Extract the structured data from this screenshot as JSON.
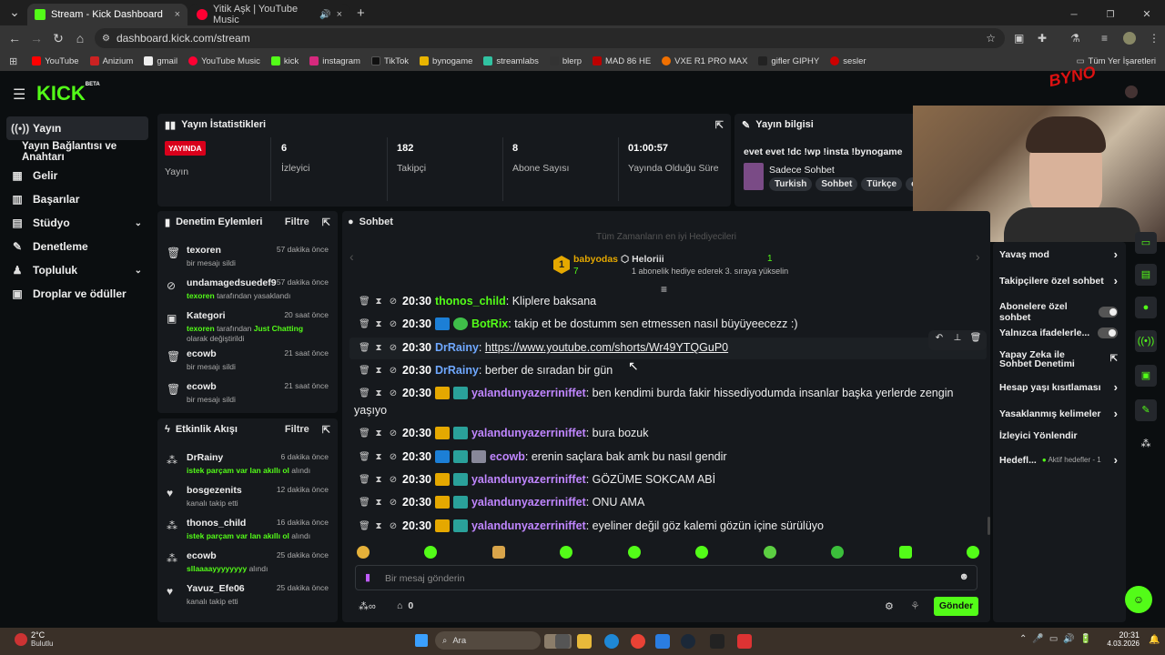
{
  "tabs": [
    {
      "title": "Stream - Kick Dashboard",
      "close": "×"
    },
    {
      "title": "Yitik Aşk | YouTube Music",
      "close": "×"
    }
  ],
  "new_tab": "+",
  "window_controls": {
    "min": "─",
    "max": "❐",
    "close": "✕"
  },
  "url": "dashboard.kick.com/stream",
  "bookmarks": [
    "YouTube",
    "Anizium",
    "gmail",
    "YouTube Music",
    "kick",
    "instagram",
    "TikTok",
    "bynogame",
    "streamlabs",
    "blerp",
    "MAD 86 HE",
    "VXE R1 PRO MAX",
    "gifler GIPHY",
    "sesler"
  ],
  "bookmarks_all": "Tüm Yer İşaretleri",
  "logo": "KICK",
  "logo_beta": "BETA",
  "sidebar": {
    "items": [
      {
        "label": "Yayın",
        "icon": "stream-icon"
      },
      {
        "label": "Yayın Bağlantısı ve Anahtarı",
        "icon": ""
      },
      {
        "label": "Gelir",
        "icon": "revenue-icon"
      },
      {
        "label": "Başarılar",
        "icon": "trophy-icon"
      },
      {
        "label": "Stüdyo",
        "icon": "studio-icon",
        "chev": "⌄"
      },
      {
        "label": "Denetleme",
        "icon": "wrench-icon"
      },
      {
        "label": "Topluluk",
        "icon": "community-icon",
        "chev": "⌄"
      },
      {
        "label": "Droplar ve ödüller",
        "icon": "drops-icon"
      }
    ]
  },
  "stats": {
    "title": "Yayın İstatistikleri",
    "live_badge": "YAYINDA",
    "items": [
      {
        "value": "",
        "label": "Yayın"
      },
      {
        "value": "6",
        "label": "İzleyici"
      },
      {
        "value": "182",
        "label": "Takipçi"
      },
      {
        "value": "8",
        "label": "Abone Sayısı"
      },
      {
        "value": "01:00:57",
        "label": "Yayında Olduğu Süre"
      }
    ]
  },
  "info": {
    "title": "Yayın bilgisi",
    "stream_title": "evet evet !dc !wp !insta !bynogame",
    "category": "Sadece Sohbet",
    "tags": [
      "Turkish",
      "Sohbet",
      "Türkçe",
      "ch"
    ]
  },
  "moderation": {
    "title": "Denetim Eylemleri",
    "filter": "Filtre",
    "items": [
      {
        "user": "texoren",
        "desc": "bir mesajı sildi",
        "time": "57 dakika önce",
        "icon": "trash-icon"
      },
      {
        "user": "undamagedsuedef9",
        "desc_user": "texoren",
        "desc": "tarafından yasaklandı",
        "time": "57 dakika önce",
        "icon": "ban-icon"
      },
      {
        "user": "Kategori",
        "desc_user": "texoren",
        "desc": "tarafından",
        "desc_green": "Just Chatting",
        "desc2": "olarak değiştirildi",
        "time": "20 saat önce",
        "icon": "category-icon"
      },
      {
        "user": "ecowb",
        "desc": "bir mesajı sildi",
        "time": "21 saat önce",
        "icon": "trash-icon"
      },
      {
        "user": "ecowb",
        "desc": "bir mesajı sildi",
        "time": "21 saat önce",
        "icon": "trash-icon"
      }
    ]
  },
  "activity": {
    "title": "Etkinlik Akışı",
    "filter": "Filtre",
    "items": [
      {
        "user": "DrRainy",
        "green": "istek parçam var lan akıllı ol",
        "desc": "alındı",
        "time": "6 dakika önce",
        "icon": "points-icon"
      },
      {
        "user": "bosgezenits",
        "desc": "kanalı takip etti",
        "time": "12 dakika önce",
        "icon": "heart-icon"
      },
      {
        "user": "thonos_child",
        "green": "istek parçam var lan akıllı ol",
        "desc": "alındı",
        "time": "16 dakika önce",
        "icon": "points-icon"
      },
      {
        "user": "ecowb",
        "green": "sllaaaayyyyyyyy",
        "desc": "alındı",
        "time": "25 dakika önce",
        "icon": "points-icon"
      },
      {
        "user": "Yavuz_Efe06",
        "desc": "kanalı takip etti",
        "time": "25 dakika önce",
        "icon": "heart-icon"
      }
    ]
  },
  "chat": {
    "title": "Sohbet",
    "top_gifters": "Tüm Zamanların en iyi Hediyecileri",
    "gifter1": {
      "rank": "1",
      "name": "babyodas",
      "count": "7"
    },
    "gifter2": {
      "name": "Heloriii",
      "count": "1",
      "desc": "1 abonelik hediye ederek 3. sıraya yükselin"
    },
    "messages": [
      {
        "time": "20:30",
        "user": "thonos_child",
        "color": "#53fc18",
        "badges": [],
        "text": ": Kliplere baksana"
      },
      {
        "time": "20:30",
        "user": "BotRix",
        "color": "#53fc18",
        "badges": [
          "vip",
          "ver"
        ],
        "text": ": takip et be dostumm sen etmessen nasıl büyüyeecezz :)"
      },
      {
        "time": "20:30",
        "user": "DrRainy",
        "color": "#6fa8ff",
        "badges": [],
        "text": ": ",
        "link": "https://www.youtube.com/shorts/Wr49YTQGuP0"
      },
      {
        "time": "20:30",
        "user": "DrRainy",
        "color": "#6fa8ff",
        "badges": [],
        "text": ": berber de sıradan bir gün"
      },
      {
        "time": "20:30",
        "user": "yalandunyazerriniffet",
        "color": "#c086ff",
        "badges": [
          "crown",
          "sub"
        ],
        "text": ": ben kendimi burda fakir hissediyodumda insanlar başka yerlerde zengin",
        "cont": "yaşıyo"
      },
      {
        "time": "20:30",
        "user": "yalandunyazerriniffet",
        "color": "#c086ff",
        "badges": [
          "crown",
          "sub"
        ],
        "text": ": bura bozuk"
      },
      {
        "time": "20:30",
        "user": "ecowb",
        "color": "#c086ff",
        "badges": [
          "vip",
          "sub",
          "avatar"
        ],
        "text": ": erenin saçlara bak amk bu nasıl gendir"
      },
      {
        "time": "20:30",
        "user": "yalandunyazerriniffet",
        "color": "#c086ff",
        "badges": [
          "crown",
          "sub"
        ],
        "text": ": GÖZÜME SOKCAM ABİ"
      },
      {
        "time": "20:30",
        "user": "yalandunyazerriniffet",
        "color": "#c086ff",
        "badges": [
          "crown",
          "sub"
        ],
        "text": ": ONU AMA"
      },
      {
        "time": "20:30",
        "user": "yalandunyazerriniffet",
        "color": "#c086ff",
        "badges": [
          "crown",
          "sub"
        ],
        "text": ": eyeliner değil göz kalemi gözün içine sürülüyo"
      }
    ],
    "placeholder": "Bir mesaj gönderin",
    "points": "0",
    "send": "Gönder"
  },
  "chat_settings": {
    "items": [
      {
        "label": "Yavaş mod",
        "type": "arrow"
      },
      {
        "label": "Takipçilere özel sohbet",
        "type": "arrow"
      },
      {
        "label": "Abonelere özel sohbet",
        "type": "toggle"
      },
      {
        "label": "Yalnızca ifadelerle...",
        "type": "toggle"
      },
      {
        "label": "Yapay Zeka ile Sohbet Denetimi",
        "type": "external"
      },
      {
        "label": "Hesap yaşı kısıtlaması",
        "type": "arrow"
      },
      {
        "label": "Yasaklanmış kelimeler",
        "type": "arrow"
      },
      {
        "label": "İzleyici Yönlendir",
        "type": "none"
      },
      {
        "label": "Hedefl...",
        "sub": "Aktif hedefler - 1",
        "type": "arrow"
      }
    ]
  },
  "overlay_text": "BYNO",
  "taskbar": {
    "weather_temp": "2°C",
    "weather_desc": "Bulutlu",
    "search": "Ara",
    "time": "20:31",
    "date": "4.03.2026"
  },
  "colors": {
    "accent": "#53fc18",
    "live": "#d9001b"
  }
}
